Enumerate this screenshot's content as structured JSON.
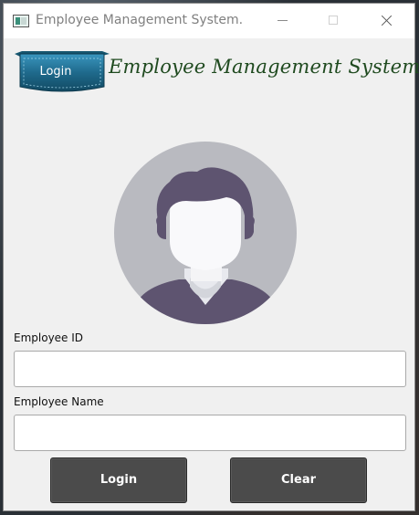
{
  "window": {
    "title": "Employee Management System."
  },
  "header": {
    "badge_label": "Login",
    "title": "Employee Management System"
  },
  "form": {
    "employee_id": {
      "label": "Employee ID",
      "value": ""
    },
    "employee_name": {
      "label": "Employee Name",
      "value": ""
    }
  },
  "buttons": {
    "login_label": "Login",
    "clear_label": "Clear"
  },
  "colors": {
    "badge": "#1f6a8c",
    "header_title": "#1f4a1f",
    "avatar_bg": "#b9bac0",
    "avatar_hair": "#5e5470",
    "button_bg": "#4b4b4b"
  },
  "icons": {
    "app": "app-window-icon",
    "avatar": "user-avatar-icon"
  }
}
